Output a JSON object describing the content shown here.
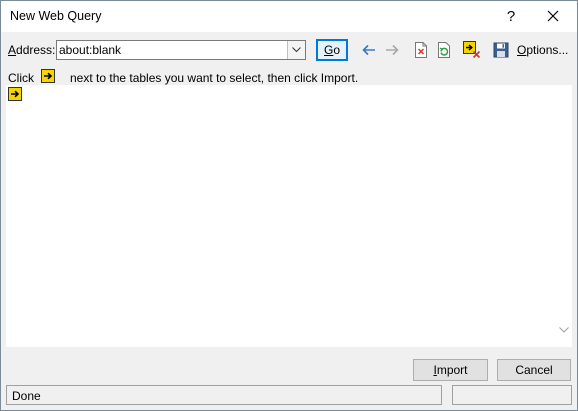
{
  "window": {
    "title": "New Web Query"
  },
  "toolbar": {
    "address_label": "Address:",
    "address_value": "about:blank",
    "go_label": "Go",
    "options_label": "Options..."
  },
  "instructions": {
    "click_word": "Click",
    "rest": "next to the tables you want to select, then click Import."
  },
  "buttons": {
    "import_label": "Import",
    "cancel_label": "Cancel"
  },
  "status": {
    "text": "Done"
  },
  "icons": {
    "help": "help-icon",
    "close": "close-icon",
    "back": "back-arrow-icon",
    "forward": "forward-arrow-icon",
    "stop": "stop-icon",
    "refresh": "refresh-icon",
    "hide_icons": "hide-icons-icon",
    "save_query": "save-query-icon",
    "table_select": "table-select-arrow-icon"
  },
  "colors": {
    "accent": "#0078d7",
    "select_arrow_bg": "#f5d400",
    "stop_red": "#d9342b"
  }
}
